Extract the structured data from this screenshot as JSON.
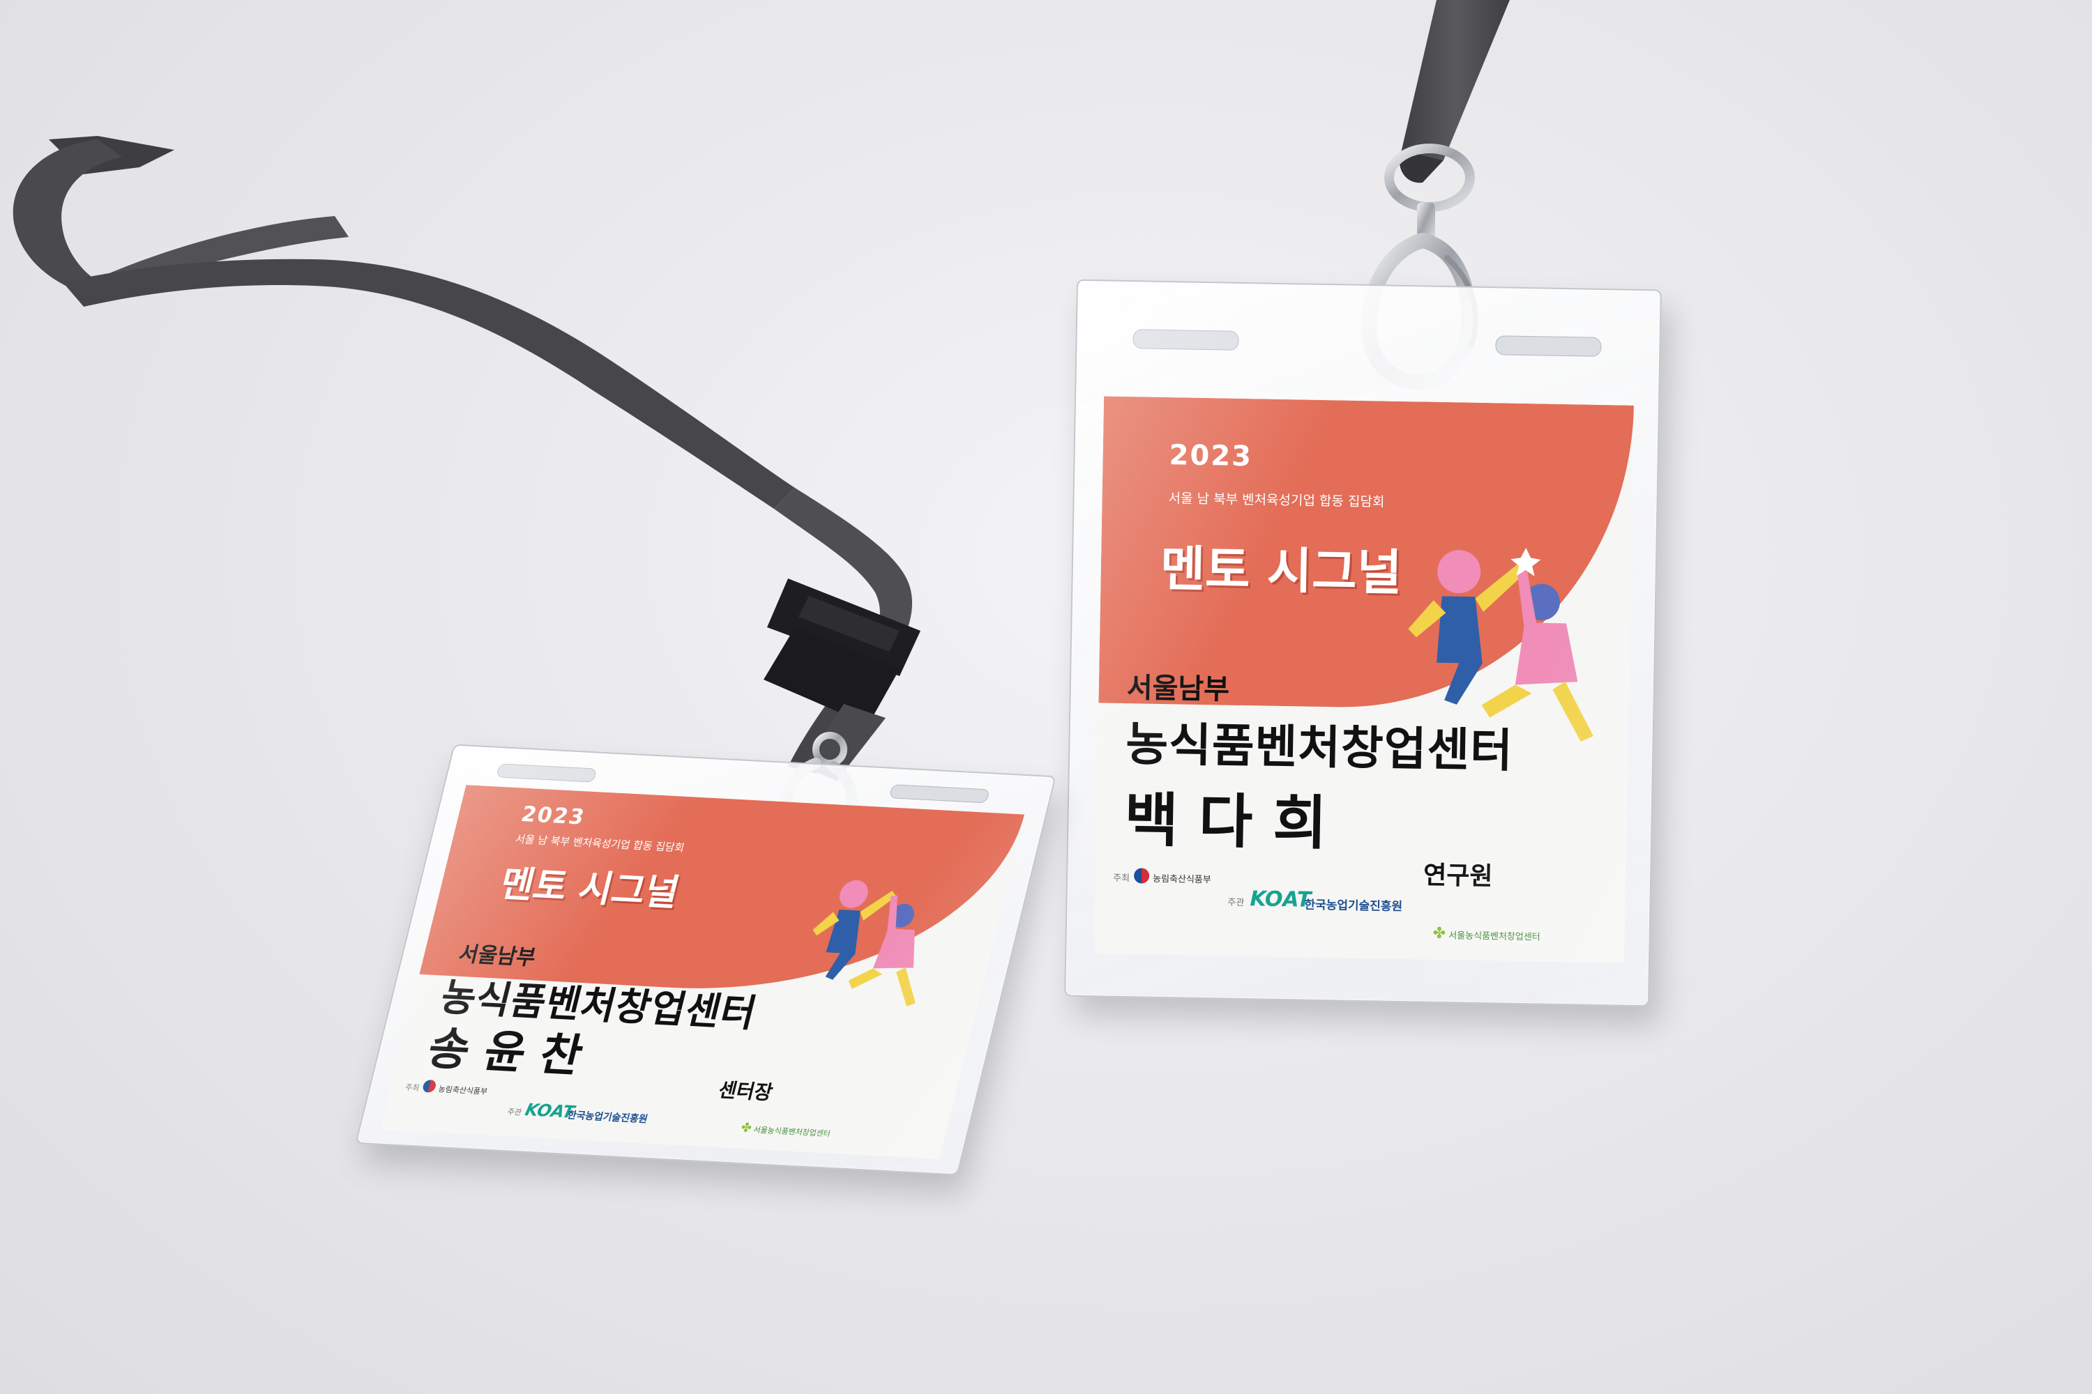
{
  "badges": [
    {
      "id": "badge-front-left",
      "year": "2023",
      "event_subtitle": "서울 남 북부 벤처육성기업 합동 집담회",
      "event_title": "멘토 시그널",
      "organization_region": "서울남부",
      "organization_name": "농식품벤처창업센터",
      "person_name": "송 윤 찬",
      "person_role": "센터장",
      "host_label": "주최",
      "host_name": "농림축산식품부",
      "organizer_label": "주관",
      "organizer_logo": "KOAT",
      "organizer_name": "한국농업기술진흥원",
      "center_logo_text": "서울농식품벤처창업센터"
    },
    {
      "id": "badge-back-right",
      "year": "2023",
      "event_subtitle": "서울 남 북부 벤처육성기업 합동 집담회",
      "event_title": "멘토 시그널",
      "organization_region": "서울남부",
      "organization_name": "농식품벤처창업센터",
      "person_name": "백 다 희",
      "person_role": "연구원",
      "host_label": "주최",
      "host_name": "농림축산식품부",
      "organizer_label": "주관",
      "organizer_logo": "KOAT",
      "organizer_name": "한국농업기술진흥원",
      "center_logo_text": "서울농식품벤처창업센터"
    }
  ],
  "colors": {
    "background": "#e6e6e9",
    "lanyard": "#4a4a4c",
    "card_band": "#e36d57",
    "card_body": "#f6f6f4",
    "koat_green": "#16a38f",
    "koat_blue": "#1d4f91",
    "center_green": "#3d8a36",
    "clip_metal": "#b9bcc1",
    "buckle": "#1e1e20"
  }
}
